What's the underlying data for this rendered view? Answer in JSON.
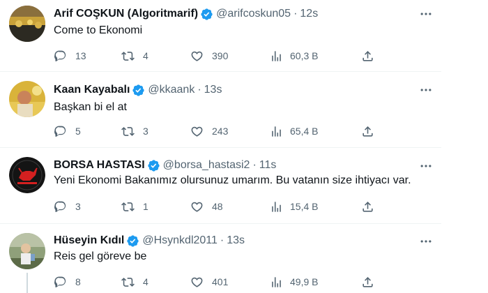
{
  "colors": {
    "verified": "#1d9bf0",
    "muted": "#536471",
    "text": "#0f1419",
    "divider": "#eff3f4"
  },
  "icons": {
    "reply": "reply-icon",
    "retweet": "retweet-icon",
    "like": "heart-icon",
    "views": "views-bar-chart-icon",
    "share": "share-icon",
    "more": "more-dots-icon",
    "verified": "verified-badge-icon"
  },
  "tweets": [
    {
      "name": "Arif COŞKUN (Algoritmarif)",
      "handle": "@arifcoskun05",
      "dot": "·",
      "time": "12s",
      "text": "Come to Ekonomi",
      "replies": "13",
      "retweets": "4",
      "likes": "390",
      "views": "60,3 B"
    },
    {
      "name": "Kaan Kayabalı",
      "handle": "@kkaank",
      "dot": "·",
      "time": "13s",
      "text": "Başkan bi el at",
      "replies": "5",
      "retweets": "3",
      "likes": "243",
      "views": "65,4 B"
    },
    {
      "name": "BORSA HASTASI",
      "handle": "@borsa_hastasi2",
      "dot": "·",
      "time": "11s",
      "text": "Yeni Ekonomi Bakanımız olursunuz umarım. Bu vatanın size ihtiyacı var.",
      "replies": "3",
      "retweets": "1",
      "likes": "48",
      "views": "15,4 B"
    },
    {
      "name": "Hüseyin Kıdıl",
      "handle": "@Hsynkdl2011",
      "dot": "·",
      "time": "13s",
      "text": "Reis gel göreve be",
      "replies": "8",
      "retweets": "4",
      "likes": "401",
      "views": "49,9 B"
    }
  ]
}
